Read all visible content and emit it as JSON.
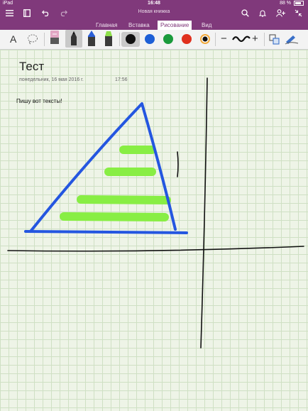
{
  "status": {
    "device": "iPad",
    "time": "16:48",
    "battery": "88 %"
  },
  "titlebar": {
    "notebook_title": "Новая книжка"
  },
  "tabs": [
    {
      "label": "Главная"
    },
    {
      "label": "Вставка"
    },
    {
      "label": "Рисование",
      "active": true
    },
    {
      "label": "Вид"
    }
  ],
  "ribbon": {
    "text_tool_label": "A",
    "minus_label": "−",
    "plus_label": "+",
    "colors": [
      "#111111",
      "#1e5fd6",
      "#1a9a3c",
      "#e0301e"
    ],
    "highlighter_color": "#8de04a"
  },
  "page": {
    "title": "Тест",
    "date": "понедельник, 16 мая 2016 г.",
    "time": "17:56",
    "text": "Пишу вот тексты!"
  },
  "ink": {
    "triangle_color": "#2456e0",
    "highlight_color": "#88ee44",
    "axes_color": "#111111"
  }
}
